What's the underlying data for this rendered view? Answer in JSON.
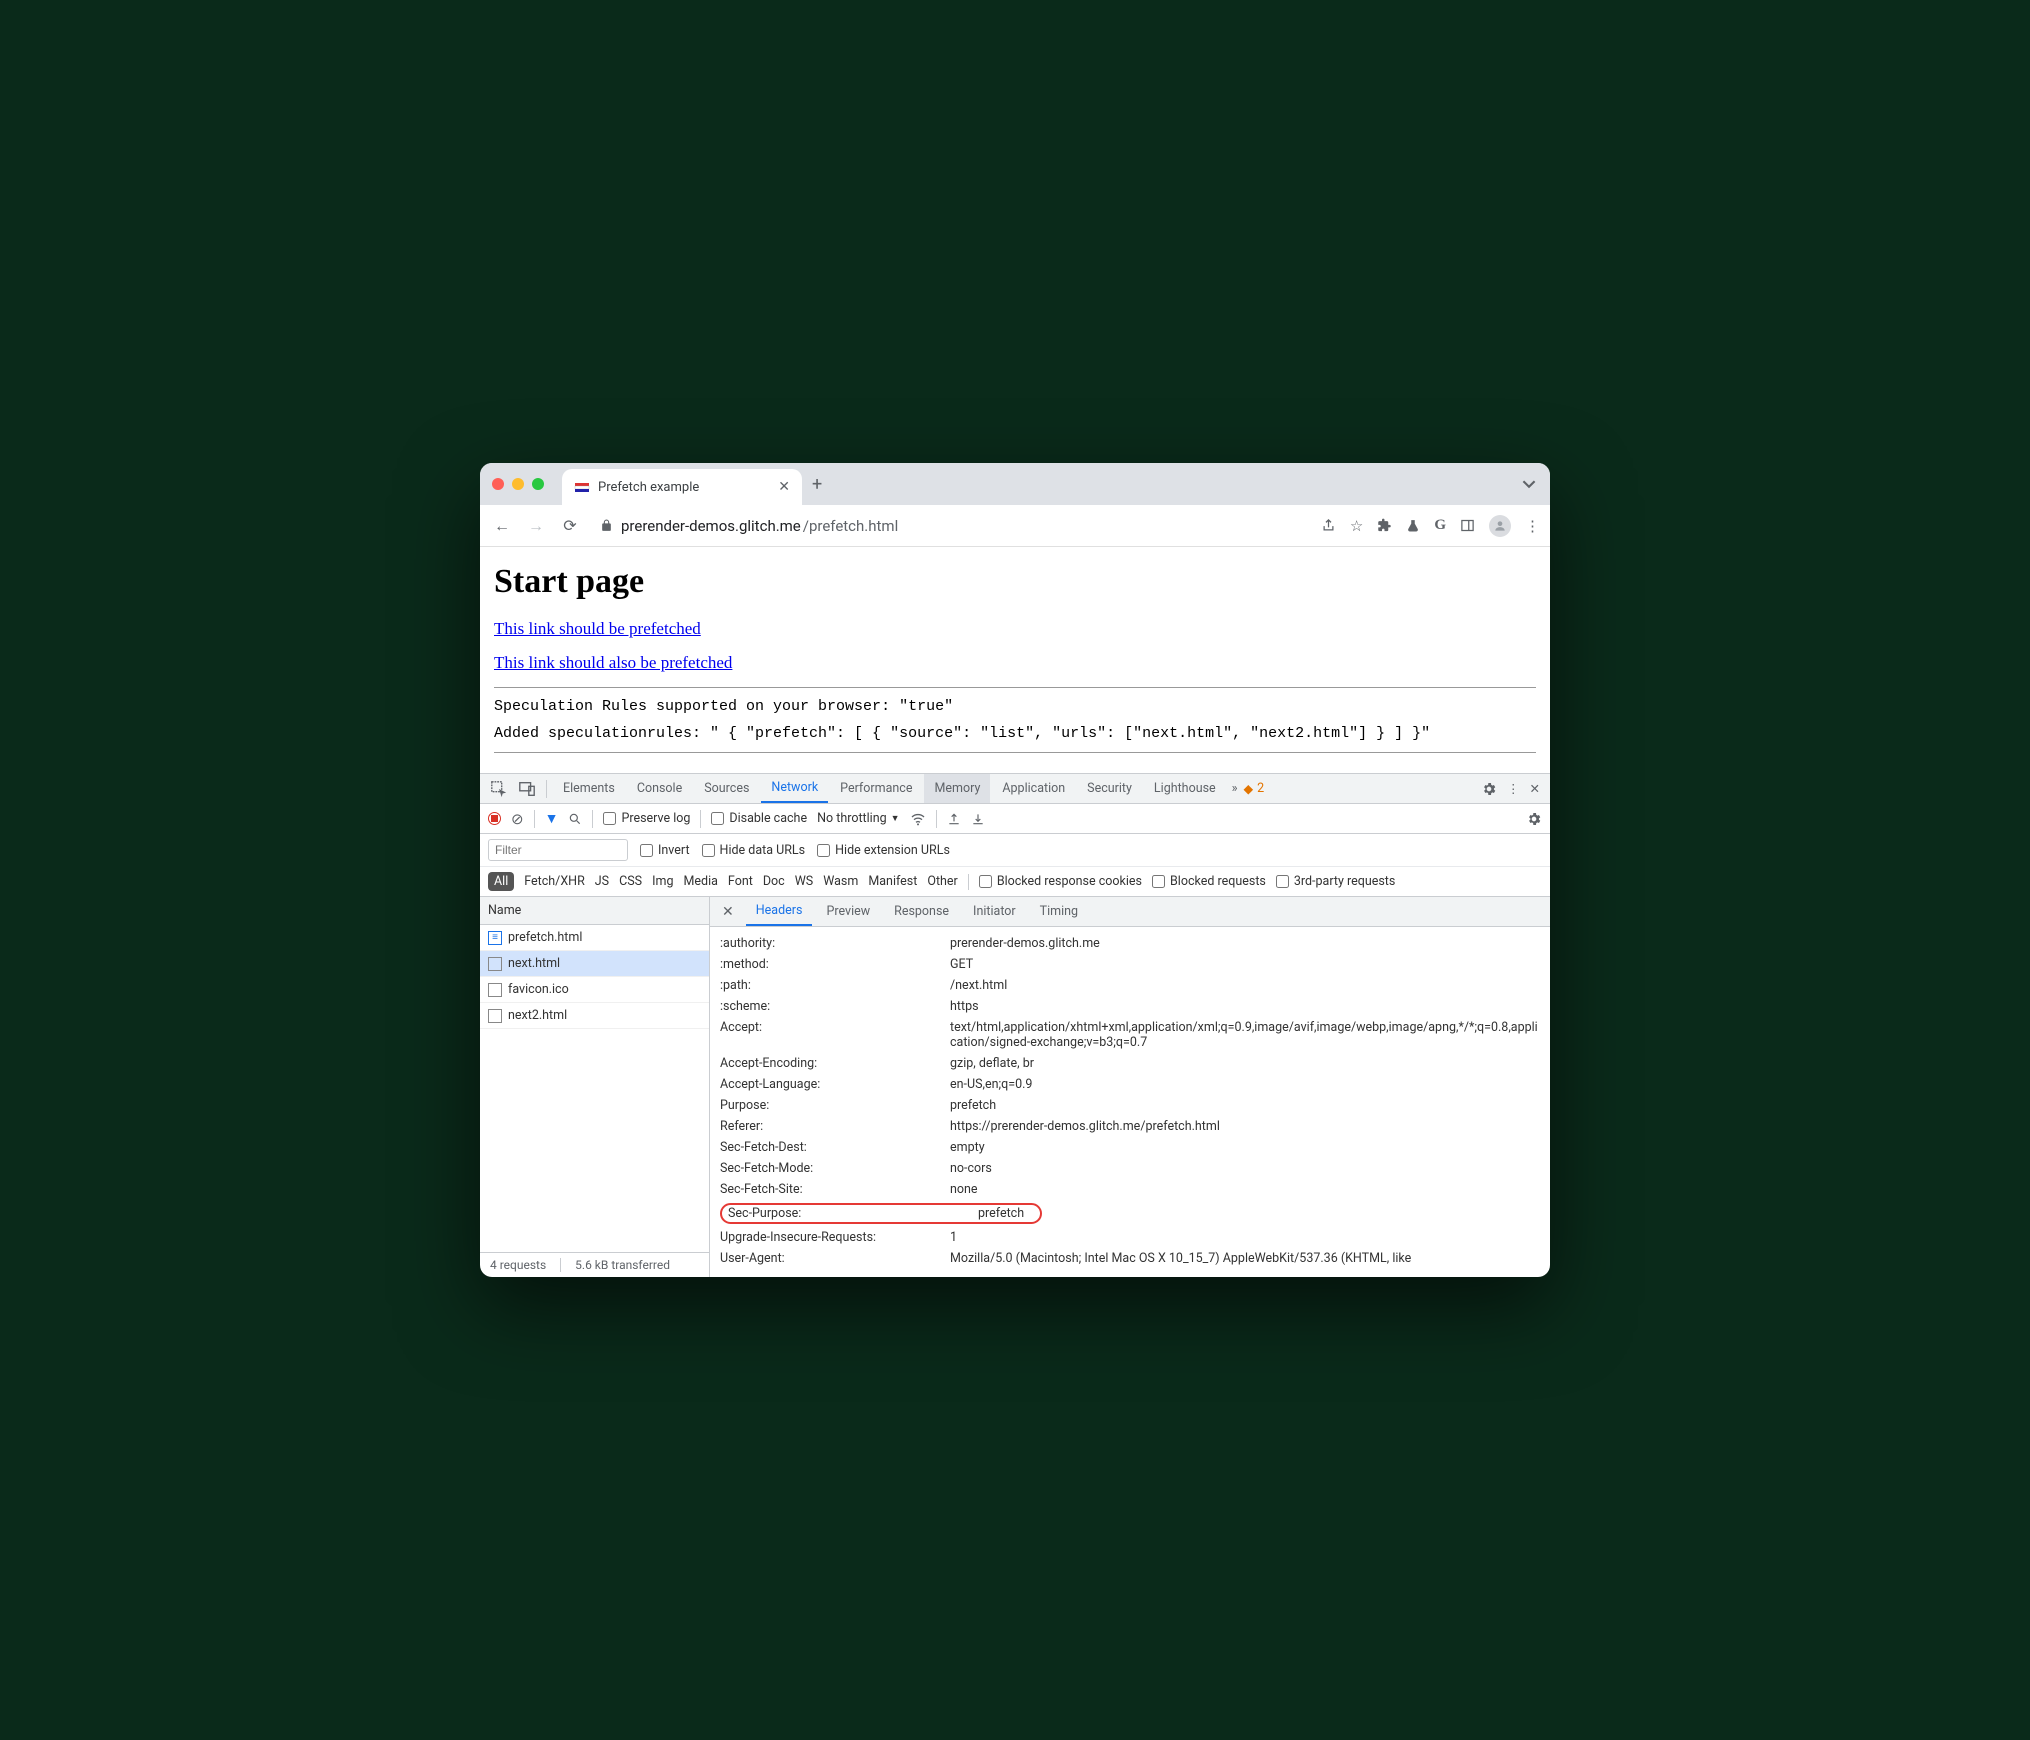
{
  "browser": {
    "tab_title": "Prefetch example",
    "url_domain": "prerender-demos.glitch.me",
    "url_path": "/prefetch.html"
  },
  "page": {
    "heading": "Start page",
    "link1": "This link should be prefetched",
    "link2": "This link should also be prefetched",
    "status1": "Speculation Rules supported on your browser: \"true\"",
    "status2": "Added speculationrules: \" { \"prefetch\": [ { \"source\": \"list\", \"urls\": [\"next.html\", \"next2.html\"] } ] }\""
  },
  "devtools": {
    "panels": [
      "Elements",
      "Console",
      "Sources",
      "Network",
      "Performance",
      "Memory",
      "Application",
      "Security",
      "Lighthouse"
    ],
    "warn_count": "2",
    "preserve_log": "Preserve log",
    "disable_cache": "Disable cache",
    "throttling": "No throttling",
    "filter_placeholder": "Filter",
    "invert": "Invert",
    "hide_data": "Hide data URLs",
    "hide_ext": "Hide extension URLs",
    "types": [
      "All",
      "Fetch/XHR",
      "JS",
      "CSS",
      "Img",
      "Media",
      "Font",
      "Doc",
      "WS",
      "Wasm",
      "Manifest",
      "Other"
    ],
    "blocked_cookies": "Blocked response cookies",
    "blocked_req": "Blocked requests",
    "third_party": "3rd-party requests",
    "name_header": "Name",
    "requests": [
      {
        "name": "prefetch.html",
        "type": "doc"
      },
      {
        "name": "next.html",
        "type": "gen",
        "selected": true
      },
      {
        "name": "favicon.ico",
        "type": "gen"
      },
      {
        "name": "next2.html",
        "type": "gen"
      }
    ],
    "detail_tabs": [
      "Headers",
      "Preview",
      "Response",
      "Initiator",
      "Timing"
    ],
    "headers": [
      {
        "k": ":authority:",
        "v": "prerender-demos.glitch.me"
      },
      {
        "k": ":method:",
        "v": "GET"
      },
      {
        "k": ":path:",
        "v": "/next.html"
      },
      {
        "k": ":scheme:",
        "v": "https"
      },
      {
        "k": "Accept:",
        "v": "text/html,application/xhtml+xml,application/xml;q=0.9,image/avif,image/webp,image/apng,*/*;q=0.8,application/signed-exchange;v=b3;q=0.7"
      },
      {
        "k": "Accept-Encoding:",
        "v": "gzip, deflate, br"
      },
      {
        "k": "Accept-Language:",
        "v": "en-US,en;q=0.9"
      },
      {
        "k": "Purpose:",
        "v": "prefetch"
      },
      {
        "k": "Referer:",
        "v": "https://prerender-demos.glitch.me/prefetch.html"
      },
      {
        "k": "Sec-Fetch-Dest:",
        "v": "empty"
      },
      {
        "k": "Sec-Fetch-Mode:",
        "v": "no-cors"
      },
      {
        "k": "Sec-Fetch-Site:",
        "v": "none"
      },
      {
        "k": "Sec-Purpose:",
        "v": "prefetch",
        "highlight": true
      },
      {
        "k": "Upgrade-Insecure-Requests:",
        "v": "1"
      },
      {
        "k": "User-Agent:",
        "v": "Mozilla/5.0 (Macintosh; Intel Mac OS X 10_15_7) AppleWebKit/537.36 (KHTML, like"
      }
    ],
    "status": {
      "requests": "4 requests",
      "transferred": "5.6 kB transferred"
    }
  }
}
